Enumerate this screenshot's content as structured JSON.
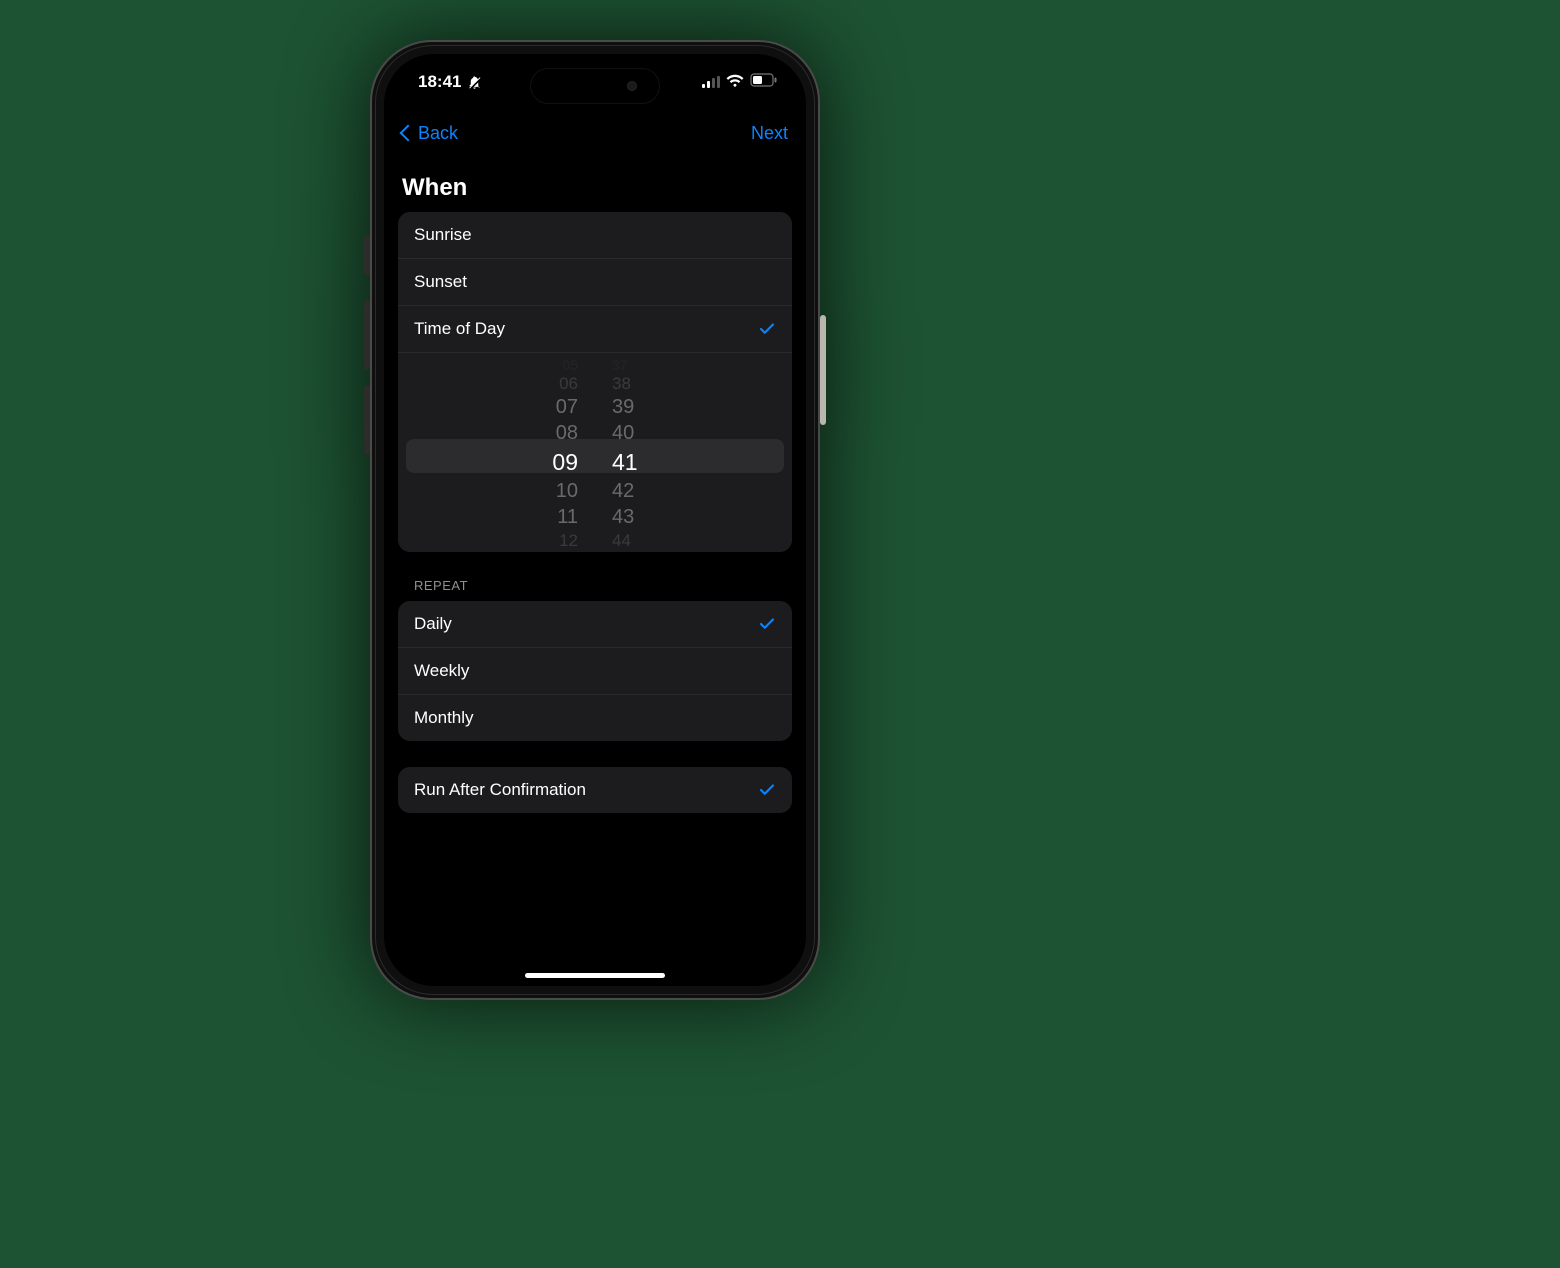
{
  "status": {
    "time": "18:41"
  },
  "nav": {
    "back": "Back",
    "next": "Next"
  },
  "title": "When",
  "when_options": {
    "sunrise": "Sunrise",
    "sunset": "Sunset",
    "time_of_day": "Time of Day"
  },
  "time_picker": {
    "hours": [
      "05",
      "06",
      "07",
      "08",
      "09",
      "10",
      "11",
      "12"
    ],
    "minutes": [
      "37",
      "38",
      "39",
      "40",
      "41",
      "42",
      "43",
      "44"
    ],
    "selected_hour": "09",
    "selected_minute": "41"
  },
  "repeat": {
    "header": "REPEAT",
    "daily": "Daily",
    "weekly": "Weekly",
    "monthly": "Monthly"
  },
  "confirmation": {
    "label": "Run After Confirmation"
  },
  "colors": {
    "accent": "#0a84ff"
  }
}
